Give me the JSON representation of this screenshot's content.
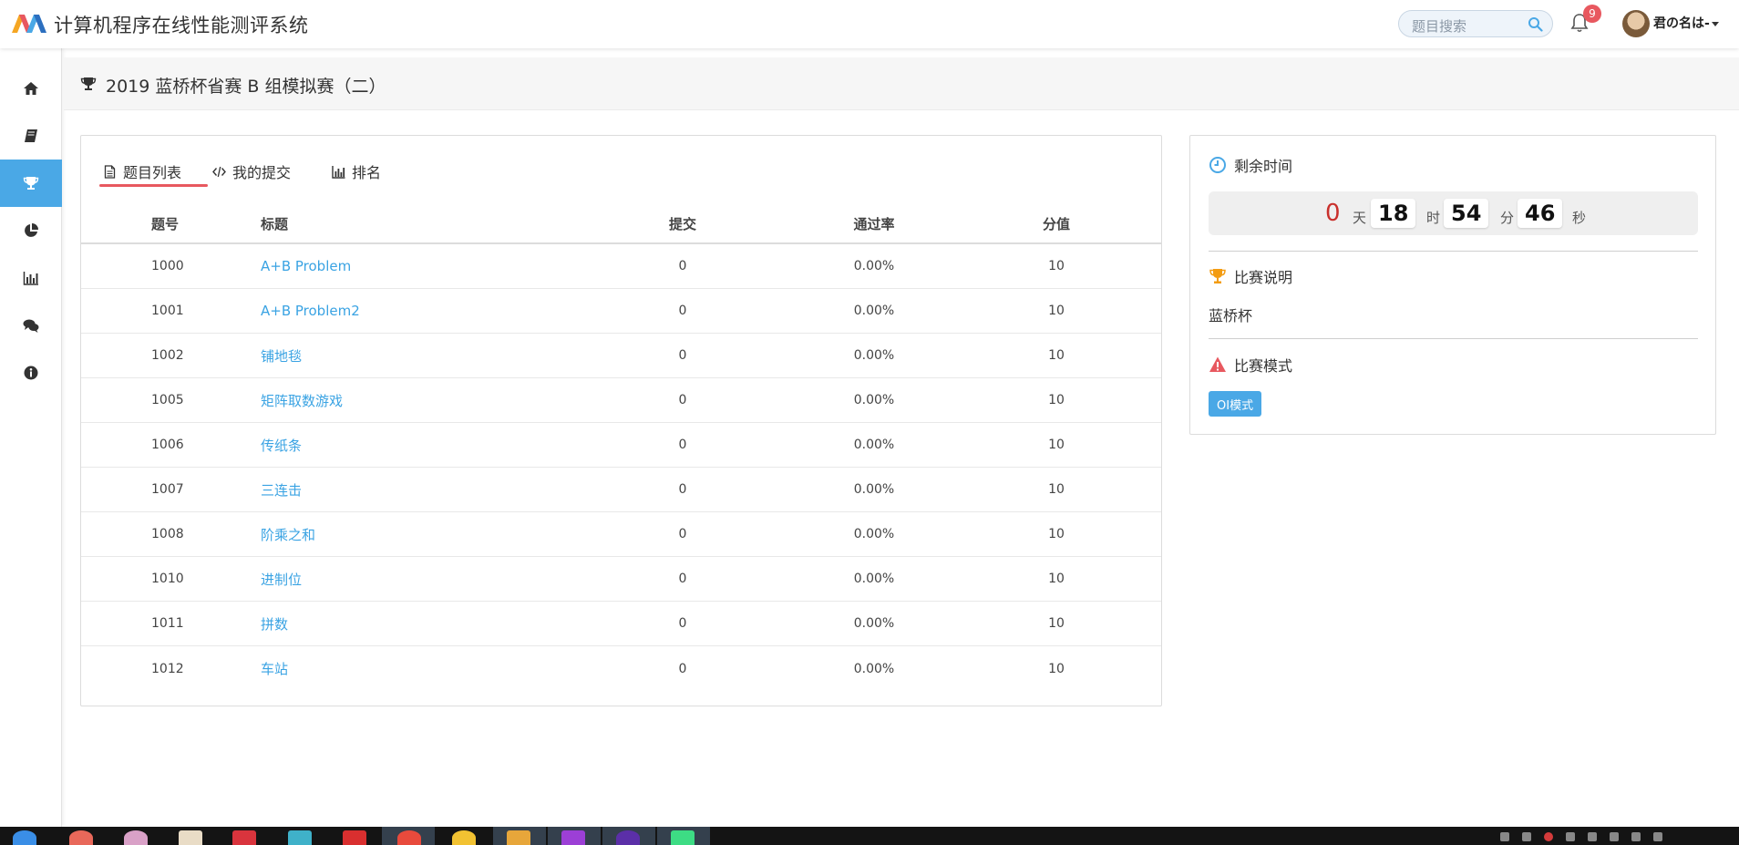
{
  "app": {
    "title": "计算机程序在线性能测评系统",
    "accent_color": "#4aa8e6",
    "logo_icon": "mountain-logo"
  },
  "header": {
    "search_placeholder": "题目搜索",
    "notification_count": "9",
    "username": "君の名は-"
  },
  "sidebar": {
    "items": [
      {
        "icon": "home-icon",
        "active": false
      },
      {
        "icon": "book-icon",
        "active": false
      },
      {
        "icon": "trophy-icon",
        "active": true
      },
      {
        "icon": "pie-chart-icon",
        "active": false
      },
      {
        "icon": "bar-chart-icon",
        "active": false
      },
      {
        "icon": "comments-icon",
        "active": false
      },
      {
        "icon": "info-icon",
        "active": false
      }
    ]
  },
  "contest": {
    "title": "2019 蓝桥杯省赛 B 组模拟赛（二）"
  },
  "tabs": [
    {
      "label": "题目列表",
      "icon": "file-text-icon",
      "active": true
    },
    {
      "label": "我的提交",
      "icon": "code-icon",
      "active": false
    },
    {
      "label": "排名",
      "icon": "bar-chart-icon",
      "active": false
    }
  ],
  "table": {
    "headers": {
      "id": "题号",
      "title": "标题",
      "submissions": "提交",
      "pass_rate": "通过率",
      "score": "分值"
    },
    "rows": [
      {
        "id": "1000",
        "title": "A+B Problem",
        "submissions": "0",
        "pass_rate": "0.00%",
        "score": "10"
      },
      {
        "id": "1001",
        "title": "A+B Problem2",
        "submissions": "0",
        "pass_rate": "0.00%",
        "score": "10"
      },
      {
        "id": "1002",
        "title": "铺地毯",
        "submissions": "0",
        "pass_rate": "0.00%",
        "score": "10"
      },
      {
        "id": "1005",
        "title": "矩阵取数游戏",
        "submissions": "0",
        "pass_rate": "0.00%",
        "score": "10"
      },
      {
        "id": "1006",
        "title": "传纸条",
        "submissions": "0",
        "pass_rate": "0.00%",
        "score": "10"
      },
      {
        "id": "1007",
        "title": "三连击",
        "submissions": "0",
        "pass_rate": "0.00%",
        "score": "10"
      },
      {
        "id": "1008",
        "title": "阶乘之和",
        "submissions": "0",
        "pass_rate": "0.00%",
        "score": "10"
      },
      {
        "id": "1010",
        "title": "进制位",
        "submissions": "0",
        "pass_rate": "0.00%",
        "score": "10"
      },
      {
        "id": "1011",
        "title": "拼数",
        "submissions": "0",
        "pass_rate": "0.00%",
        "score": "10"
      },
      {
        "id": "1012",
        "title": "车站",
        "submissions": "0",
        "pass_rate": "0.00%",
        "score": "10"
      }
    ]
  },
  "side_panel": {
    "remaining_label": "剩余时间",
    "countdown": {
      "days": "0",
      "days_unit": "天",
      "hours": "18",
      "hours_unit": "时",
      "minutes": "54",
      "minutes_unit": "分",
      "seconds": "46",
      "seconds_unit": "秒"
    },
    "description_label": "比赛说明",
    "description": "蓝桥杯",
    "mode_label": "比赛模式",
    "mode_badge": "OI模式"
  }
}
